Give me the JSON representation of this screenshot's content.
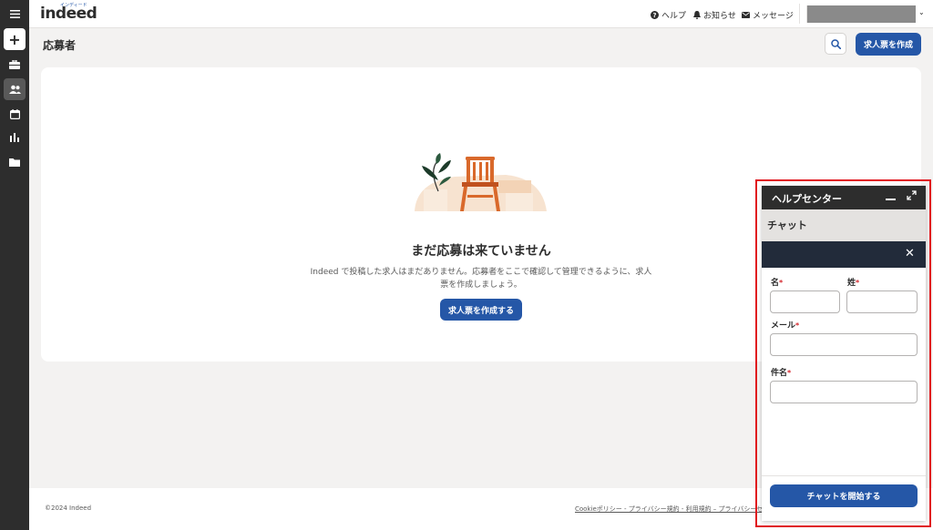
{
  "nav": {
    "items": [
      {
        "name": "menu-icon",
        "glyph": "☰"
      },
      {
        "name": "add-icon",
        "glyph": "+"
      },
      {
        "name": "briefcase-icon",
        "glyph": "▣"
      },
      {
        "name": "people-icon",
        "glyph": "👥"
      },
      {
        "name": "calendar-icon",
        "glyph": "▦"
      },
      {
        "name": "chart-icon",
        "glyph": "▮"
      },
      {
        "name": "folder-icon",
        "glyph": "▬"
      }
    ]
  },
  "header": {
    "logo": "indeed",
    "logo_sub": "インディード",
    "help_label": "ヘルプ",
    "notifications_label": "お知らせ",
    "messages_label": "メッセージ"
  },
  "page": {
    "title": "応募者",
    "create_button": "求人票を作成"
  },
  "empty_state": {
    "title": "まだ応募は来ていません",
    "description": "Indeed で投稿した求人はまだありません。応募者をここで確認して管理できるように、求人票を作成しましょう。",
    "button": "求人票を作成する"
  },
  "footer": {
    "copyright": "©2024 Indeed",
    "links": "Cookieポリシー - プライバシー規約 - 利用規約 – プライバシーセン"
  },
  "help_center": {
    "title": "ヘルプセンター",
    "subtitle": "チャット",
    "fields": {
      "first_name": "名",
      "last_name": "姓",
      "email": "メール",
      "subject": "件名"
    },
    "required_mark": "*",
    "start_button": "チャットを開始する"
  },
  "colors": {
    "primary": "#2557a7",
    "highlight": "#e0161e",
    "rail": "#2d2d2d"
  }
}
